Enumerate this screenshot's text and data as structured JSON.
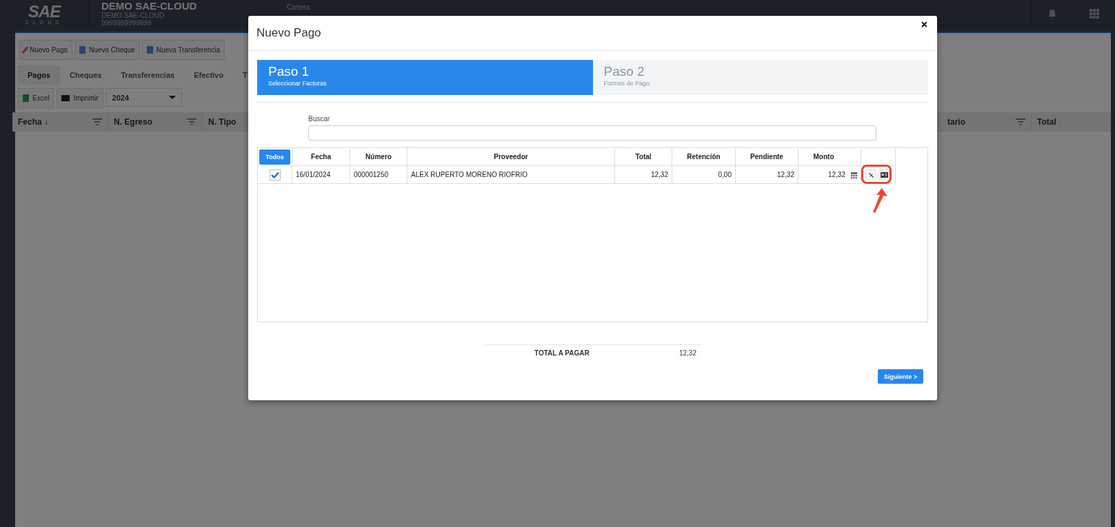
{
  "topbar": {
    "logo": "SAE",
    "logo_sub": "CLOUD",
    "company": "DEMO SAE-CLOUD",
    "company_sub": "DEMO SAE-CLOUD",
    "company_id": "9999999999999",
    "section": "Cartera"
  },
  "toolbar": [
    "Nuevo Pago",
    "Nuevo Cheque",
    "Nueva Transferencia"
  ],
  "tabs": [
    {
      "label": "Pagos",
      "selected": true
    },
    {
      "label": "Cheques",
      "selected": false
    },
    {
      "label": "Transferencias",
      "selected": false
    },
    {
      "label": "Efectivo",
      "selected": false
    },
    {
      "label": "T",
      "selected": false
    }
  ],
  "subtoolbar": {
    "excel": "Excel",
    "print": "Imprimir",
    "year": "2024"
  },
  "list_columns": [
    "Fecha ↓",
    "N. Egreso",
    "N. Tipo",
    "tario",
    "Total"
  ],
  "modal": {
    "title": "Nuevo Pago",
    "close": "×",
    "steps": [
      {
        "title": "Paso 1",
        "subtitle": "Seleccionar Facturas",
        "selected": true
      },
      {
        "title": "Paso 2",
        "subtitle": "Formas de Pago",
        "selected": false
      }
    ],
    "search": {
      "label": "Buscar"
    },
    "select_all": "Todos",
    "columns": [
      "Fecha",
      "Número",
      "Proveedor",
      "Total",
      "Retención",
      "Pendiente",
      "Monto"
    ],
    "rows": [
      {
        "checked": true,
        "cells": [
          "16/01/2024",
          "000001250",
          "ALEX RUPERTO MORENO RIOFRIO",
          "12,32",
          "0,00",
          "12,32",
          "12,32"
        ]
      }
    ],
    "total_label": "TOTAL A PAGAR",
    "total_value": "12,32",
    "next": "Siguiente >"
  }
}
